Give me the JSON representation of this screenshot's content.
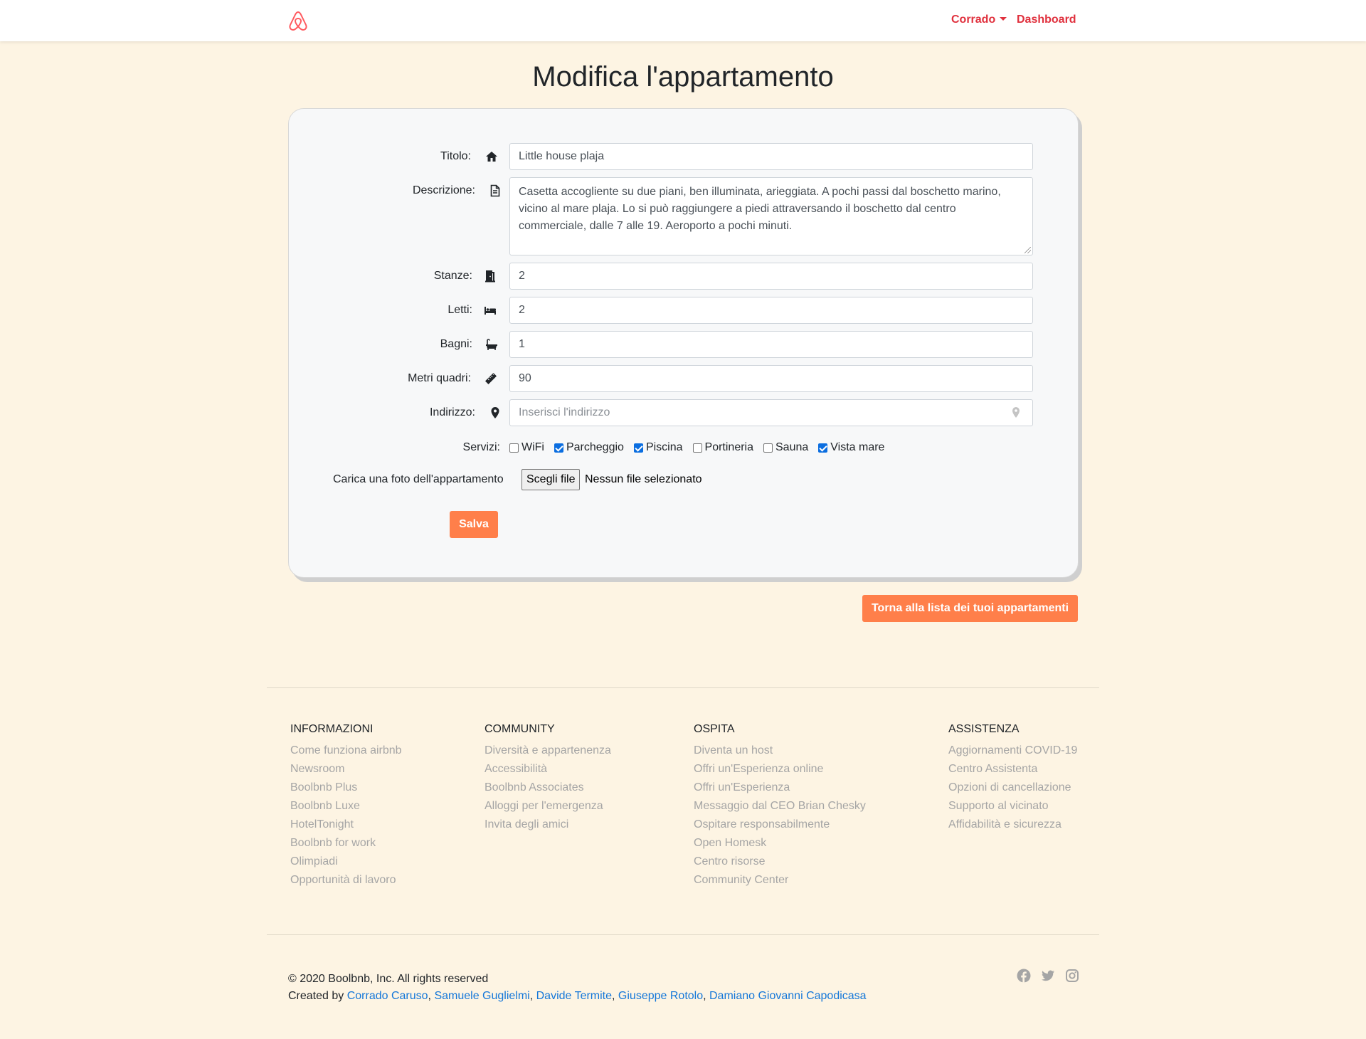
{
  "nav": {
    "user": "Corrado",
    "dashboard": "Dashboard"
  },
  "page": {
    "title": "Modifica l'appartamento"
  },
  "form": {
    "title_label": "Titolo:",
    "title_value": "Little house plaja",
    "description_label": "Descrizione:",
    "description_value": "Casetta accogliente su due piani, ben illuminata, arieggiata. A pochi passi dal boschetto marino, vicino al mare plaja. Lo si può raggiungere a piedi attraversando il boschetto dal centro commerciale, dalle 7 alle 19. Aeroporto a pochi minuti.",
    "rooms_label": "Stanze:",
    "rooms_value": "2",
    "beds_label": "Letti:",
    "beds_value": "2",
    "baths_label": "Bagni:",
    "baths_value": "1",
    "sqm_label": "Metri quadri:",
    "sqm_value": "90",
    "address_label": "Indirizzo:",
    "address_placeholder": "Inserisci l'indirizzo",
    "services_label": "Servizi:",
    "services": [
      {
        "label": "WiFi",
        "checked": false
      },
      {
        "label": "Parcheggio",
        "checked": true
      },
      {
        "label": "Piscina",
        "checked": true
      },
      {
        "label": "Portineria",
        "checked": false
      },
      {
        "label": "Sauna",
        "checked": false
      },
      {
        "label": "Vista mare",
        "checked": true
      }
    ],
    "photo_label": "Carica una foto dell'appartamento",
    "file_button": "Scegli file",
    "file_status": "Nessun file selezionato",
    "save_button": "Salva"
  },
  "back_button": "Torna alla lista dei tuoi appartamenti",
  "footer": {
    "columns": [
      {
        "title": "INFORMAZIONI",
        "links": [
          "Come funziona airbnb",
          "Newsroom",
          "Boolbnb Plus",
          "Boolbnb Luxe",
          "HotelTonight",
          "Boolbnb for work",
          "Olimpiadi",
          "Opportunità di lavoro"
        ]
      },
      {
        "title": "COMMUNITY",
        "links": [
          "Diversità e appartenenza",
          "Accessibilità",
          "Boolbnb Associates",
          "Alloggi per l'emergenza",
          "Invita degli amici"
        ]
      },
      {
        "title": "OSPITA",
        "links": [
          "Diventa un host",
          "Offri un'Esperienza online",
          "Offri un'Esperienza",
          "Messaggio dal CEO Brian Chesky",
          "Ospitare responsabilmente",
          "Open Homesk",
          "Centro risorse",
          "Community Center"
        ]
      },
      {
        "title": "ASSISTENZA",
        "links": [
          "Aggiornamenti COVID-19",
          "Centro Assistenta",
          "Opzioni di cancellazione",
          "Supporto al vicinato",
          "Affidabilità e sicurezza"
        ]
      }
    ],
    "copyright": "© 2020 Boolbnb, Inc. All rights reserved",
    "created_by": "Created by",
    "authors": [
      "Corrado Caruso",
      "Samuele Guglielmi",
      "Davide Termite",
      "Giuseppe Rotolo",
      "Damiano Giovanni Capodicasa"
    ]
  },
  "colors": {
    "accent": "#e0303d",
    "button": "#ff7f4a",
    "background": "#fdf4e3",
    "link": "#1477d9"
  },
  "icons": [
    "airbnb-logo-icon",
    "home-icon",
    "document-icon",
    "door-icon",
    "bed-icon",
    "bath-icon",
    "ruler-icon",
    "map-marker-icon",
    "facebook-icon",
    "twitter-icon",
    "instagram-icon"
  ]
}
